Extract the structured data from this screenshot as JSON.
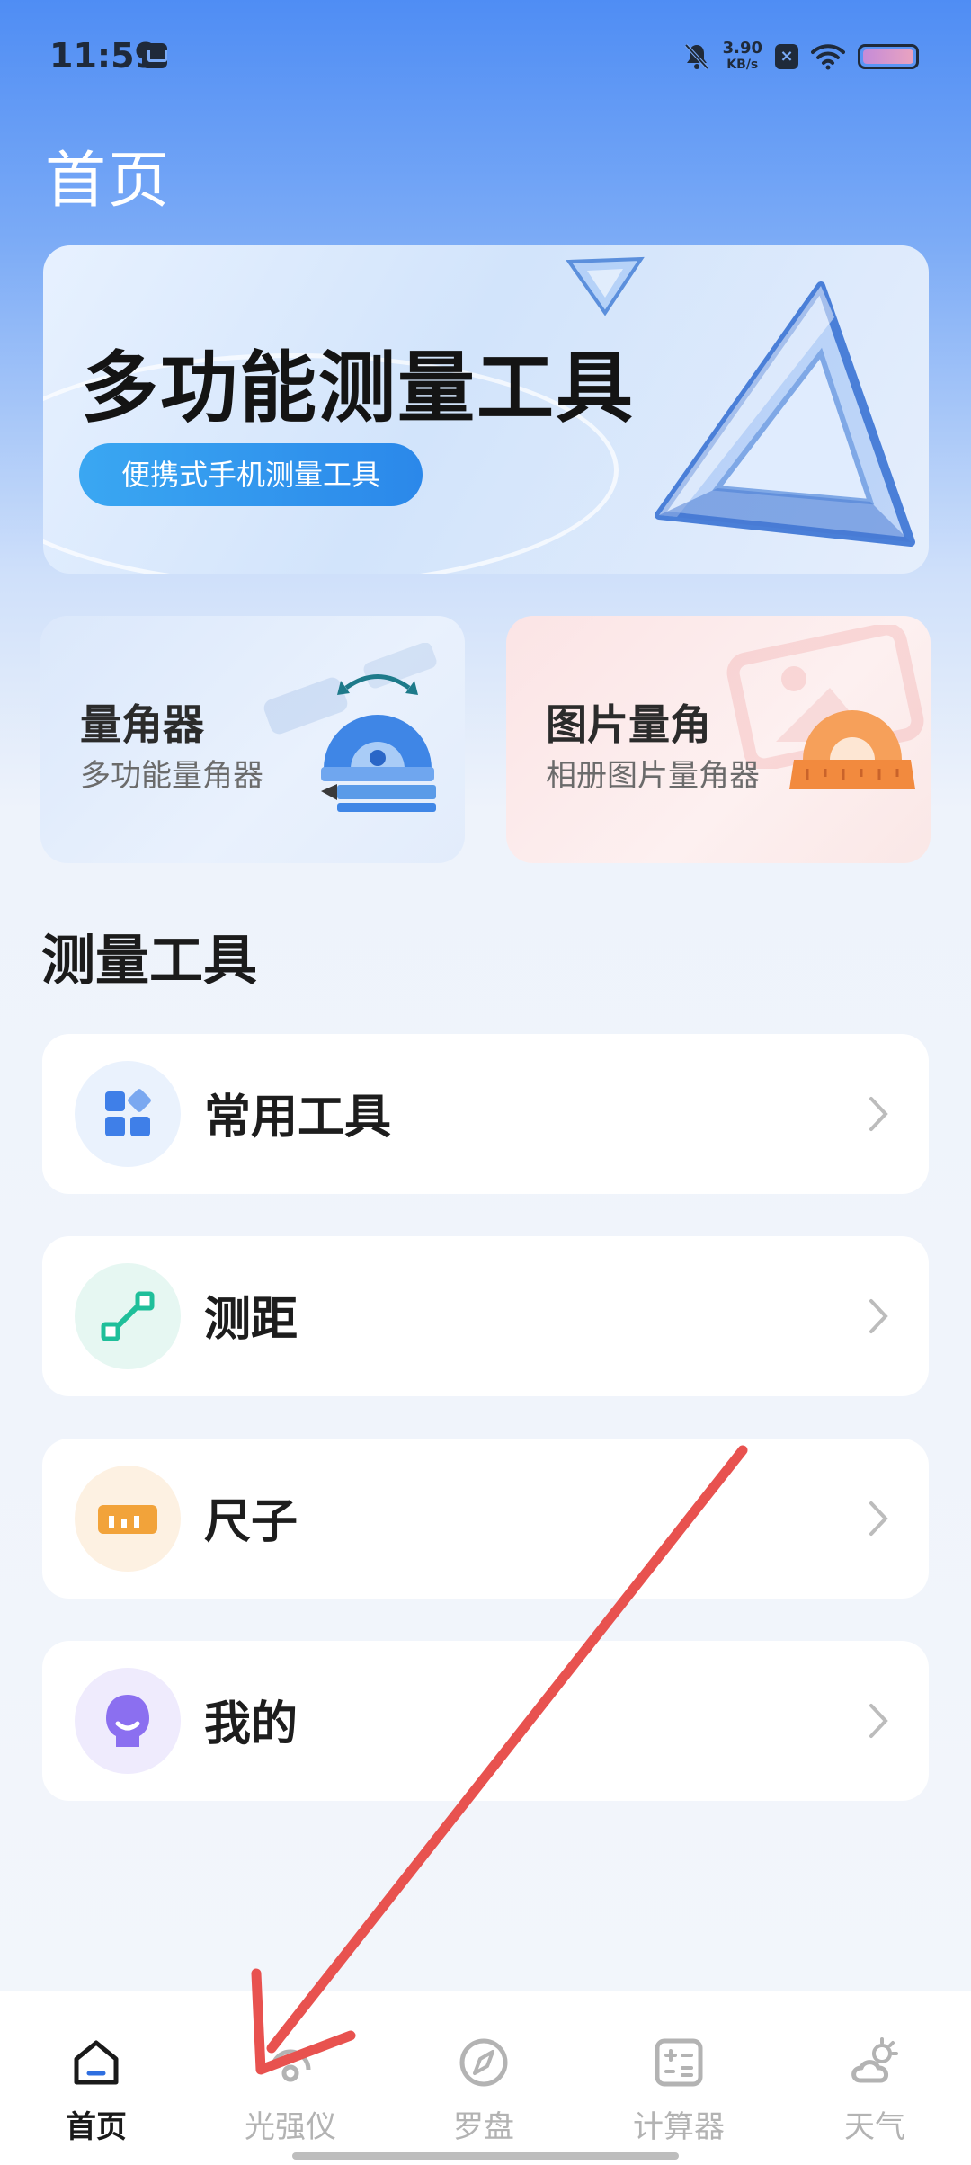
{
  "status_bar": {
    "time": "11:59",
    "net_speed_value": "3.90",
    "net_speed_unit": "KB/s",
    "x_badge": "×"
  },
  "page_title": "首页",
  "banner": {
    "title": "多功能测量工具",
    "tagline": "便携式手机测量工具"
  },
  "feature_cards": [
    {
      "title": "量角器",
      "subtitle": "多功能量角器",
      "icon": "protractor-icon"
    },
    {
      "title": "图片量角",
      "subtitle": "相册图片量角器",
      "icon": "orange-protractor-icon"
    }
  ],
  "section_title": "测量工具",
  "tool_rows": [
    {
      "label": "常用工具",
      "icon": "grid-apps-icon",
      "color": "#3f7fe8"
    },
    {
      "label": "测距",
      "icon": "measure-distance-icon",
      "color": "#1fbf9a"
    },
    {
      "label": "尺子",
      "icon": "ruler-icon",
      "color": "#f2a33a"
    },
    {
      "label": "我的",
      "icon": "profile-avatar-icon",
      "color": "#8b6ff0"
    }
  ],
  "bottom_nav": [
    {
      "label": "首页",
      "icon": "home-icon",
      "active": true
    },
    {
      "label": "光强仪",
      "icon": "light-meter-icon",
      "active": false
    },
    {
      "label": "罗盘",
      "icon": "compass-icon",
      "active": false
    },
    {
      "label": "计算器",
      "icon": "calculator-icon",
      "active": false
    },
    {
      "label": "天气",
      "icon": "weather-icon",
      "active": false
    }
  ],
  "colors": {
    "header_blue": "#4f8df4",
    "pill_blue": "#2b88ea",
    "annotation_arrow": "#e8524f"
  }
}
